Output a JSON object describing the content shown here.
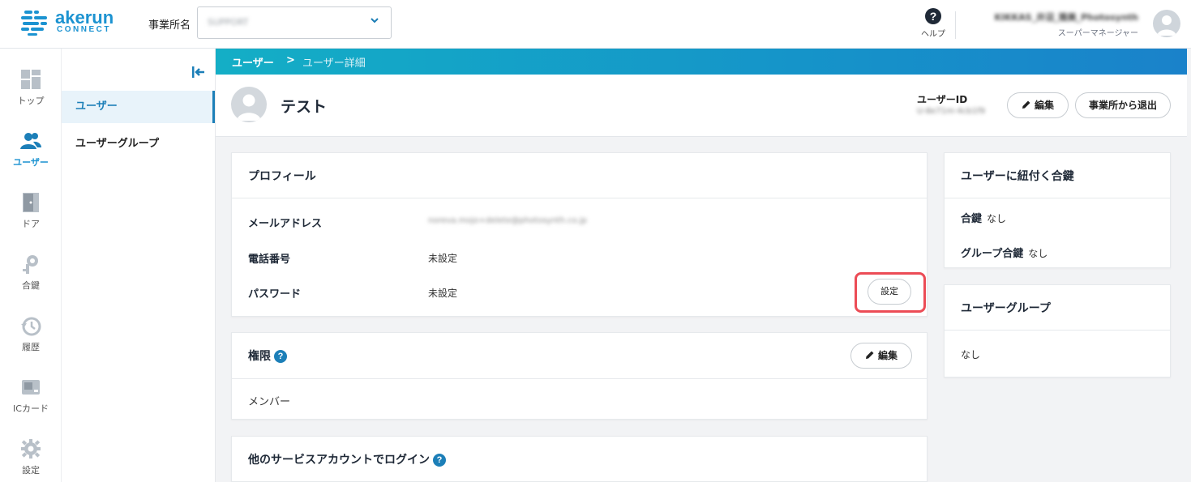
{
  "header": {
    "logo_word": "akerun",
    "logo_sub": "CONNECT",
    "office_label": "事業所名",
    "office_value": "SUPPORT",
    "help_label": "ヘルプ",
    "user_name": "KIKKAS_井沼_雅美_Photosynth",
    "user_role": "スーパーマネージャー"
  },
  "rail": [
    {
      "label": "トップ",
      "icon": "dashboard-icon"
    },
    {
      "label": "ユーザー",
      "icon": "users-icon"
    },
    {
      "label": "ドア",
      "icon": "door-icon"
    },
    {
      "label": "合鍵",
      "icon": "key-icon"
    },
    {
      "label": "履歴",
      "icon": "history-icon"
    },
    {
      "label": "ICカード",
      "icon": "ic-card-icon"
    },
    {
      "label": "設定",
      "icon": "gear-icon"
    }
  ],
  "subnav": {
    "items": [
      {
        "label": "ユーザー"
      },
      {
        "label": "ユーザーグループ"
      }
    ]
  },
  "breadcrumb": {
    "root": "ユーザー",
    "separator": ">",
    "current": "ユーザー詳細"
  },
  "user": {
    "name": "テスト",
    "id_label": "ユーザーID",
    "id_value": "U-8e71m-4cb1f9",
    "edit_label": "編集",
    "leave_label": "事業所から退出"
  },
  "profile": {
    "title": "プロフィール",
    "email_label": "メールアドレス",
    "email_value": "noreva.mojo+delete@photosynth.co.jp",
    "phone_label": "電話番号",
    "phone_value": "未設定",
    "password_label": "パスワード",
    "password_value": "未設定",
    "password_button": "設定"
  },
  "permission": {
    "title": "権限",
    "edit_label": "編集",
    "value": "メンバー"
  },
  "other_login": {
    "title": "他のサービスアカウントでログイン"
  },
  "keys": {
    "title": "ユーザーに紐付く合鍵",
    "key_label": "合鍵",
    "key_value": "なし",
    "group_key_label": "グループ合鍵",
    "group_key_value": "なし"
  },
  "groups": {
    "title": "ユーザーグループ",
    "value": "なし"
  },
  "colors": {
    "accent": "#1c93d1",
    "highlight": "#ec4c56"
  }
}
